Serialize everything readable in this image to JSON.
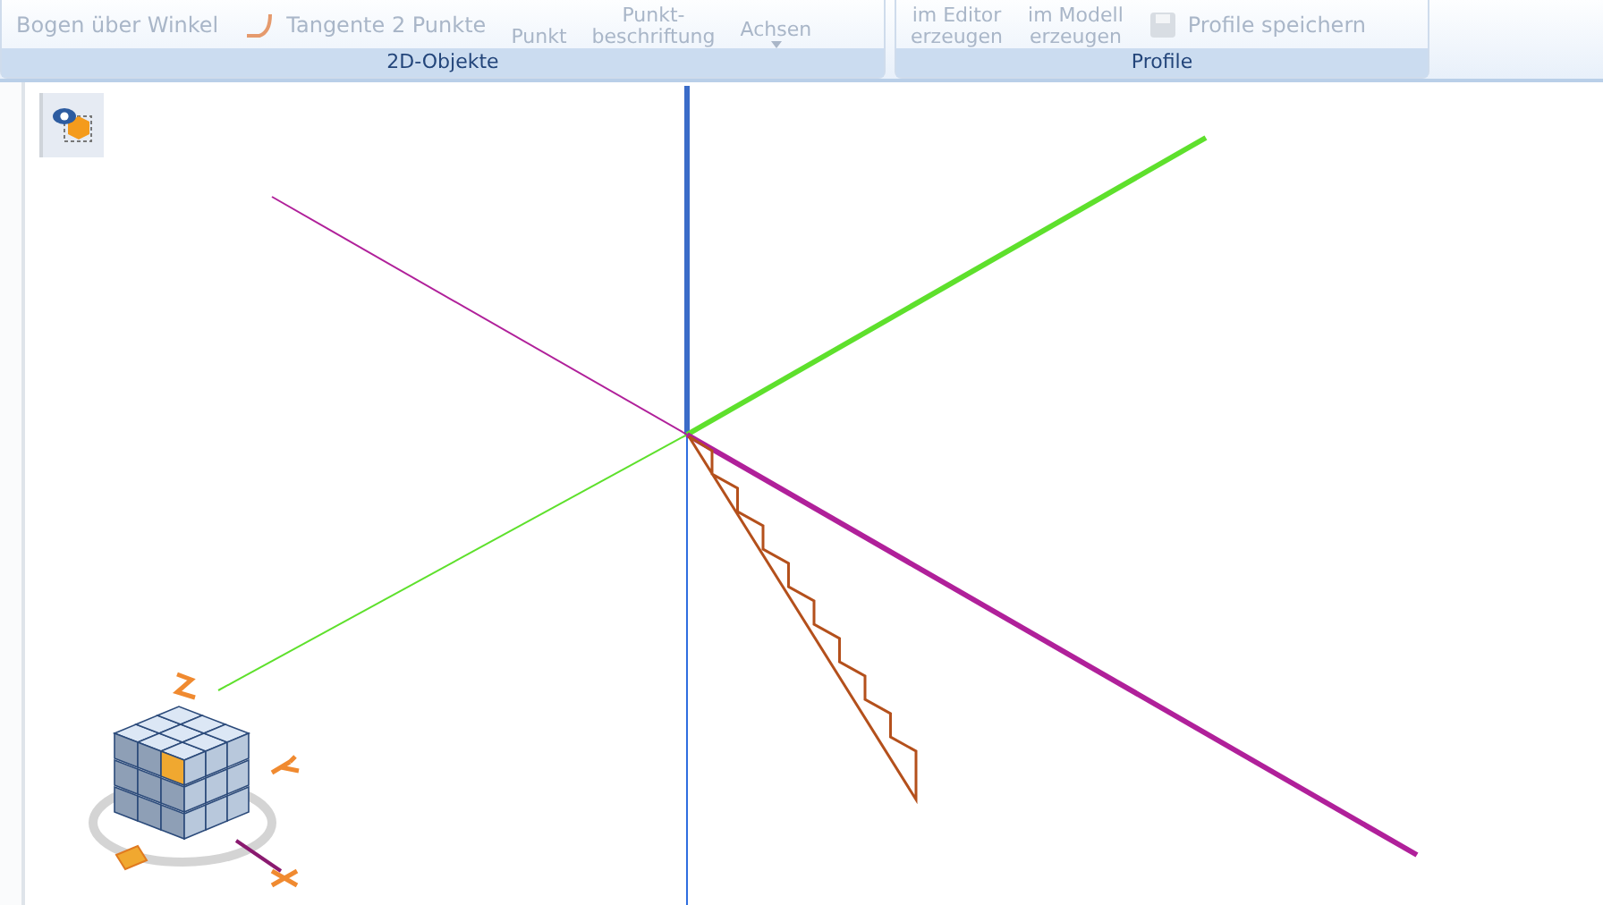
{
  "ribbon": {
    "groups": [
      {
        "label": "2D-Objekte",
        "items": [
          {
            "kind": "text",
            "lines": [
              "Bogen über Winkel"
            ]
          },
          {
            "kind": "icon-text",
            "lines": [
              "Tangente 2 Punkte"
            ]
          },
          {
            "kind": "stack",
            "lines": [
              "Punkt"
            ]
          },
          {
            "kind": "stack",
            "lines": [
              "Punkt-",
              "beschriftung"
            ]
          },
          {
            "kind": "dropdown",
            "lines": [
              "Achsen"
            ]
          }
        ]
      },
      {
        "label": "Profile",
        "items": [
          {
            "kind": "stack",
            "lines": [
              "im Editor",
              "erzeugen"
            ]
          },
          {
            "kind": "stack",
            "lines": [
              "im Modell",
              "erzeugen"
            ]
          },
          {
            "kind": "save",
            "lines": [
              "Profile speichern"
            ]
          }
        ]
      }
    ]
  },
  "view_toolbar": {
    "button": {
      "selected": true
    }
  }
}
